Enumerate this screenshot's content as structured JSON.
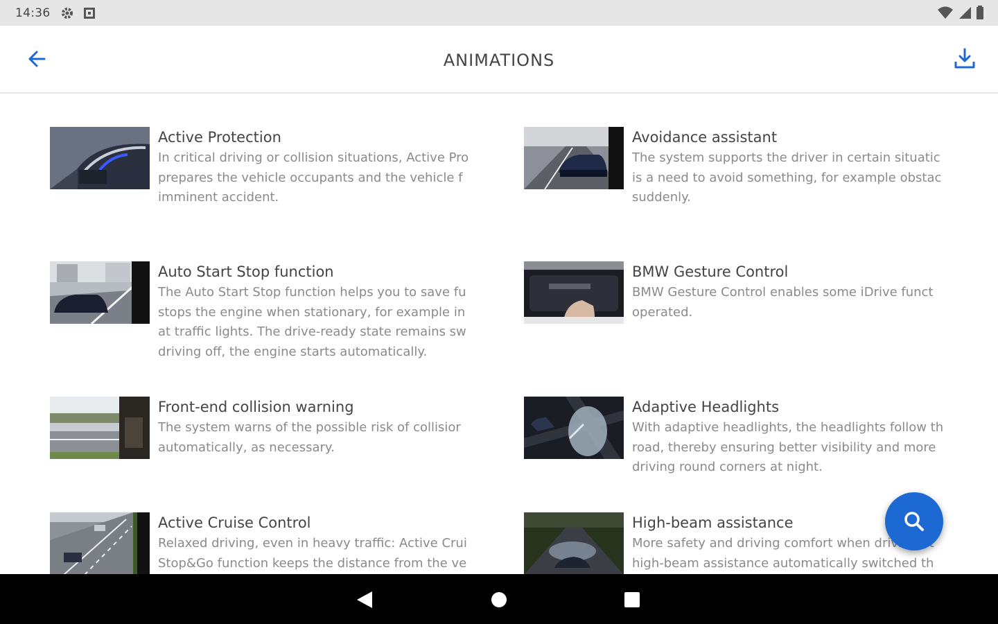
{
  "status_bar": {
    "time": "14:36",
    "icons": [
      "gear-icon",
      "notification-icon",
      "wifi-icon",
      "signal-icon",
      "battery-icon"
    ]
  },
  "app_bar": {
    "title": "ANIMATIONS",
    "back_icon": "arrow-left-icon",
    "download_icon": "download-icon",
    "accent_color": "#1c69d4"
  },
  "items": [
    {
      "title": "Active Protection",
      "description": "In critical driving or collision situations, Active Pro\nprepares the vehicle occupants and the vehicle f\nimminent accident."
    },
    {
      "title": "Avoidance assistant",
      "description": "The system supports the driver in certain situatic\nis a need to avoid something, for example obstac\nsuddenly."
    },
    {
      "title": "Auto Start Stop function",
      "description": "The Auto Start Stop function helps you to save fu\nstops the engine when stationary, for example in\nat traffic lights. The drive-ready state remains sw\ndriving off, the engine starts automatically."
    },
    {
      "title": "BMW Gesture Control",
      "description": "BMW Gesture Control enables some iDrive funct\noperated."
    },
    {
      "title": "Front-end collision warning",
      "description": "The system warns of the possible risk of collisior\nautomatically, as necessary."
    },
    {
      "title": "Adaptive Headlights",
      "description": "With adaptive headlights, the headlights follow th\nroad, thereby ensuring better visibility and more\ndriving round corners at night."
    },
    {
      "title": "Active Cruise Control",
      "description": "Relaxed driving, even in heavy traffic: Active Crui\nStop&Go function keeps the distance from the ve"
    },
    {
      "title": "High-beam assistance",
      "description": "More safety and driving comfort when driving at\nhigh-beam assistance automatically switched th"
    }
  ],
  "fab": {
    "icon": "search-icon"
  },
  "nav_bar": {
    "icons": [
      "back-triangle-icon",
      "home-circle-icon",
      "recents-square-icon"
    ]
  }
}
